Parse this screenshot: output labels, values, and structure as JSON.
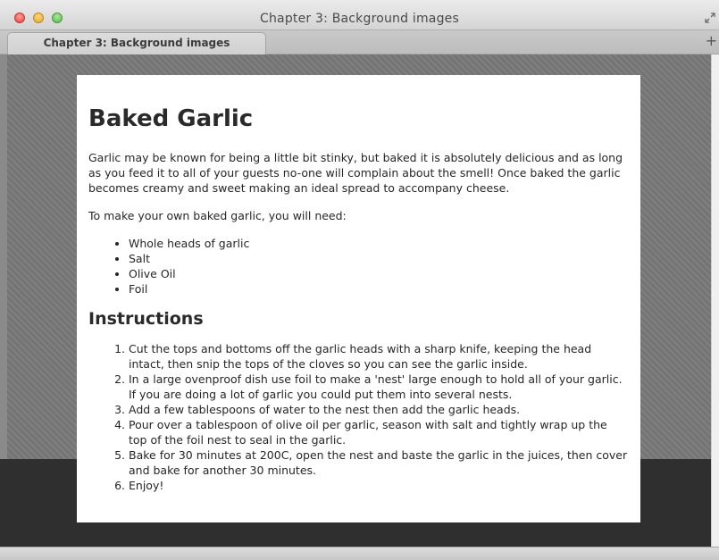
{
  "window": {
    "title": "Chapter 3: Background images"
  },
  "tabs": [
    {
      "label": "Chapter 3: Background images"
    }
  ],
  "tabbar": {
    "new_tab_label": "+"
  },
  "article": {
    "heading": "Baked Garlic",
    "intro": "Garlic may be known for being a little bit stinky, but baked it is absolutely delicious and as long as you feed it to all of your guests no-one will complain about the smell! Once baked the garlic becomes creamy and sweet making an ideal spread to accompany cheese.",
    "needs_intro": "To make your own baked garlic, you will need:",
    "ingredients": [
      "Whole heads of garlic",
      "Salt",
      "Olive Oil",
      "Foil"
    ],
    "instructions_heading": "Instructions",
    "instructions": [
      "Cut the tops and bottoms off the garlic heads with a sharp knife, keeping the head intact, then snip the tops of the cloves so you can see the garlic inside.",
      "In a large ovenproof dish use foil to make a 'nest' large enough to hold all of your garlic. If you are doing a lot of garlic you could put them into several nests.",
      "Add a few tablespoons of water to the nest then add the garlic heads.",
      "Pour over a tablespoon of olive oil per garlic, season with salt and tightly wrap up the top of the foil nest to seal in the garlic.",
      "Bake for 30 minutes at 200C, open the nest and baste the garlic in the juices, then cover and bake for another 30 minutes.",
      "Enjoy!"
    ]
  },
  "icons": {
    "close": "close-icon",
    "minimize": "minimize-icon",
    "zoom": "zoom-icon",
    "fullscreen": "fullscreen-icon"
  }
}
